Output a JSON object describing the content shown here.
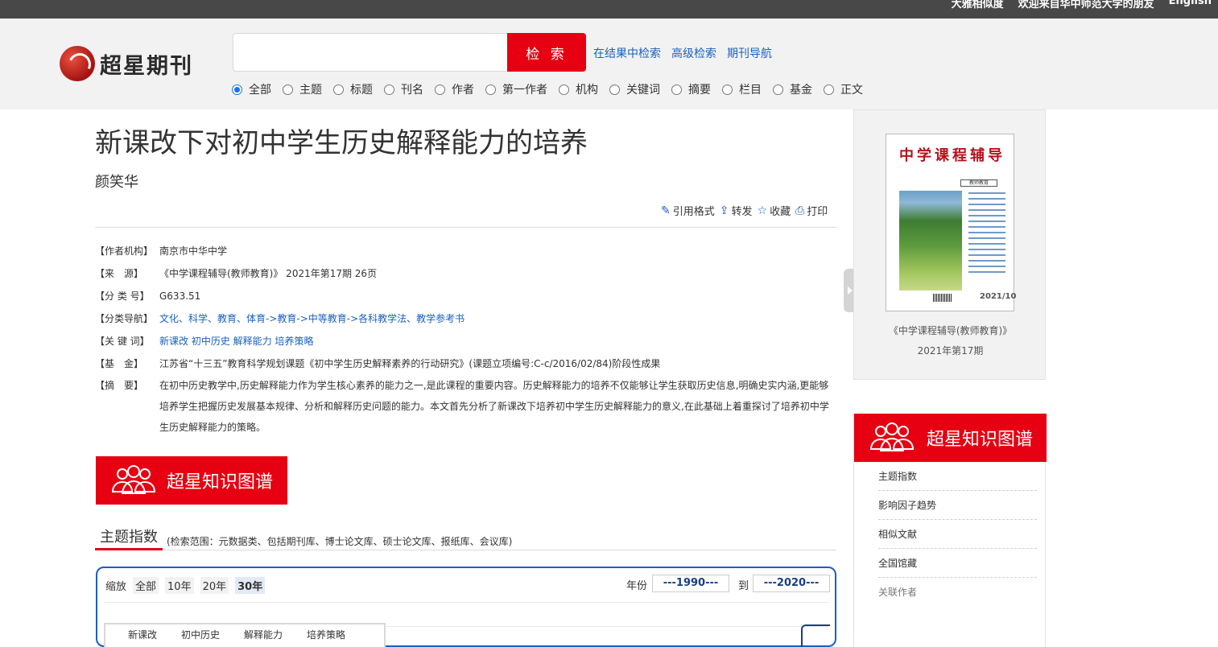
{
  "topbar": {
    "links": [
      "大雅相似度",
      "欢迎来自华中师范大学的朋友",
      "English"
    ]
  },
  "header": {
    "logo_text": "超星期刊",
    "search_placeholder": "",
    "search_button": "检 索",
    "adv_links": [
      "在结果中检索",
      "高级检索",
      "期刊导航"
    ],
    "scopes": [
      "全部",
      "主题",
      "标题",
      "刊名",
      "作者",
      "第一作者",
      "机构",
      "关键词",
      "摘要",
      "栏目",
      "基金",
      "正文"
    ],
    "selected_scope": "全部"
  },
  "article": {
    "title": "新课改下对初中学生历史解释能力的培养",
    "author": "颜笑华",
    "tools": [
      "引用格式",
      "转发",
      "收藏",
      "打印"
    ],
    "meta": [
      {
        "key": "【作者机构】",
        "value": "南京市中华中学"
      },
      {
        "key": "【来　源】",
        "value": "《中学课程辅导(教师教育)》 2021年第17期 26页"
      },
      {
        "key": "【分 类 号】",
        "value": "G633.51"
      },
      {
        "key": "【分类导航】",
        "value": "文化、科学、教育、体育->教育->中等教育->各科教学法、教学参考书"
      },
      {
        "key": "【关 键 词】",
        "value": "新课改 初中历史 解释能力 培养策略"
      },
      {
        "key": "【基　金】",
        "value": "江苏省“十三五”教育科学规划课题《初中学生历史解释素养的行动研究》(课题立项编号:C-c/2016/02/84)阶段性成果"
      },
      {
        "key": "【摘　要】",
        "value": "在初中历史教学中,历史解释能力作为学生核心素养的能力之一,是此课程的重要内容。历史解释能力的培养不仅能够让学生获取历史信息,明确史实内涵,更能够培养学生把握历史发展基本规律、分析和解释历史问题的能力。本文首先分析了新课改下培养初中学生历史解释能力的意义,在此基础上着重探讨了培养初中学生历史解释能力的策略。"
      }
    ]
  },
  "knowledge": {
    "banner": "超星知识图谱",
    "tab_title": "主题指数",
    "tab_scope": "(检索范围：元数据类、包括期刊库、博士论文库、硕士论文库、报纸库、会议库)",
    "zoom_label": "缩放",
    "zoom_options": [
      "全部",
      "10年",
      "20年",
      "30年"
    ],
    "zoom_selected": "30年",
    "year_label": "年份",
    "year_from": "---1990---",
    "to_label": "到",
    "year_to": "---2020---",
    "legend": [
      "新课改",
      "初中历史",
      "解释能力",
      "培养策略"
    ]
  },
  "sidebar": {
    "cover_title": "中学课程辅导",
    "cover_sub": "教师教育",
    "cover_year": "2021/10",
    "journal_name": "《中学课程辅导(教师教育)》",
    "issue": "2021年第17期",
    "banner": "超星知识图谱",
    "items": [
      "主题指数",
      "影响因子趋势",
      "相似文献",
      "全国馆藏",
      "关联作者"
    ]
  },
  "colors": {
    "accent": "#e60012",
    "link": "#1a61bf",
    "header_bg": "#f2f2f2",
    "topbar_bg": "#484848"
  }
}
